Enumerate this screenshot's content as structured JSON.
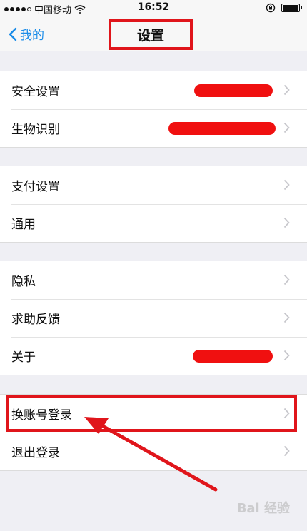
{
  "status": {
    "carrier": "中国移动",
    "time": "16:52"
  },
  "nav": {
    "back_label": "我的",
    "title": "设置"
  },
  "groups": [
    {
      "items": [
        {
          "label": "安全设置"
        },
        {
          "label": "生物识别"
        }
      ]
    },
    {
      "items": [
        {
          "label": "支付设置"
        },
        {
          "label": "通用"
        }
      ]
    },
    {
      "items": [
        {
          "label": "隐私"
        },
        {
          "label": "求助反馈"
        },
        {
          "label": "关于"
        }
      ]
    },
    {
      "items": [
        {
          "label": "换账号登录"
        },
        {
          "label": "退出登录"
        }
      ]
    }
  ],
  "watermark": "Bai  经验",
  "colors": {
    "accent": "#1a8ce8",
    "annotation": "#e0151b",
    "background": "#efeff4"
  },
  "icons": [
    "back-chevron-icon",
    "wifi-icon",
    "lock-rotation-icon",
    "battery-icon",
    "chevron-right-icon"
  ]
}
